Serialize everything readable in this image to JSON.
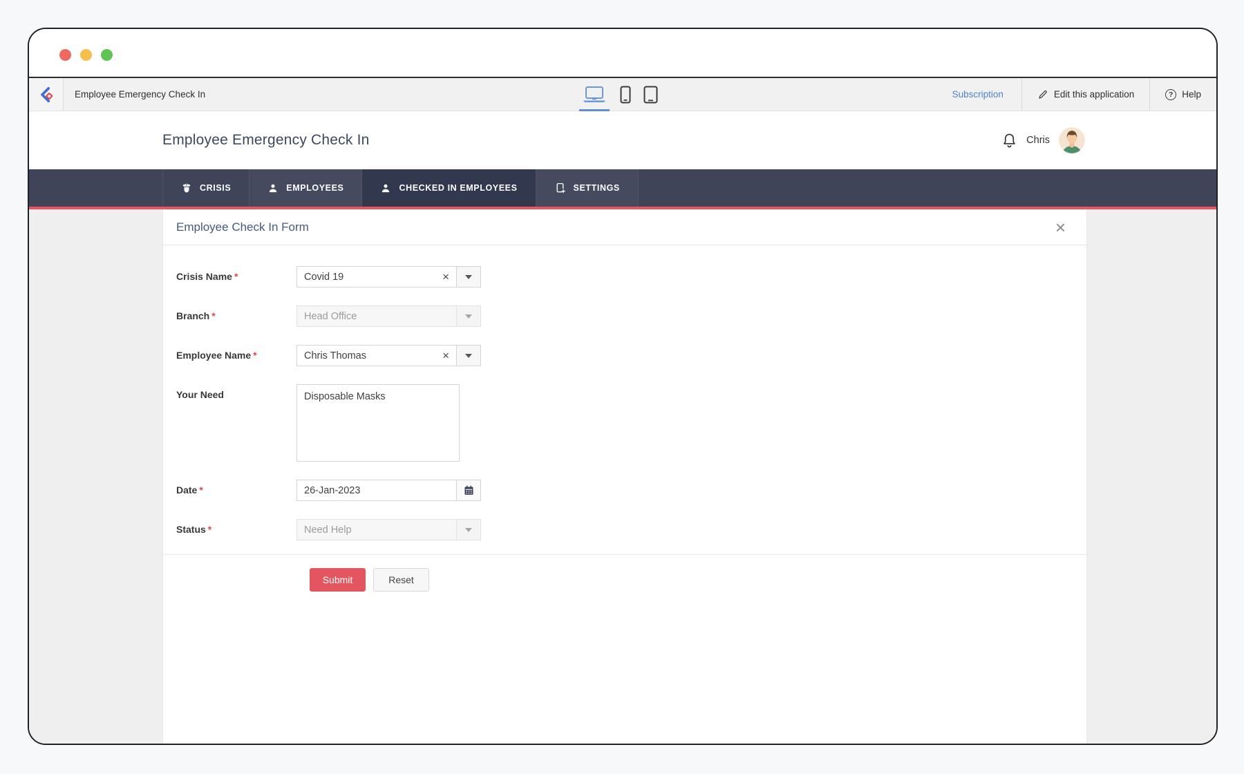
{
  "window": {
    "traffic_lights": {
      "close": "#ee6a60",
      "minimize": "#f5bf4f",
      "zoom": "#5fc454"
    }
  },
  "toolbar": {
    "app_title": "Employee Emergency Check In",
    "subscription_label": "Subscription",
    "edit_label": "Edit this application",
    "help_label": "Help"
  },
  "header": {
    "title": "Employee Emergency Check In",
    "user_name": "Chris"
  },
  "nav": {
    "tabs": [
      {
        "label": "CRISIS"
      },
      {
        "label": "EMPLOYEES"
      },
      {
        "label": "CHECKED IN EMPLOYEES",
        "active": true
      },
      {
        "label": "SETTINGS"
      }
    ]
  },
  "form": {
    "title": "Employee Check In Form",
    "required_mark": "*",
    "fields": {
      "crisis_name": {
        "label": "Crisis Name",
        "value": "Covid 19"
      },
      "branch": {
        "label": "Branch",
        "value": "Head Office",
        "disabled": true
      },
      "employee_name": {
        "label": "Employee Name",
        "value": "Chris Thomas"
      },
      "your_need": {
        "label": "Your Need",
        "value": "Disposable Masks"
      },
      "date": {
        "label": "Date",
        "value": "26-Jan-2023"
      },
      "status": {
        "label": "Status",
        "value": "Need Help",
        "disabled": true
      }
    },
    "submit_label": "Submit",
    "reset_label": "Reset"
  },
  "icons": {
    "clear": "×",
    "close": "×",
    "help": "?"
  },
  "colors": {
    "nav_bar": "#3f4459",
    "nav_accent": "#ea545c",
    "submit_red": "#e4565f",
    "subscription_link": "#4c83cf"
  }
}
